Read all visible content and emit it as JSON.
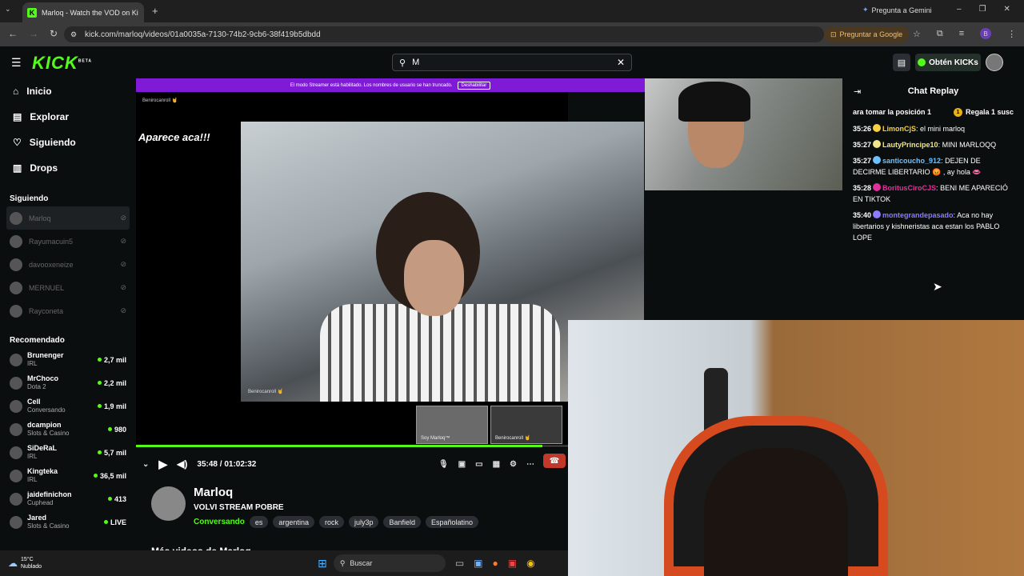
{
  "browser": {
    "tab_title": "Marloq - Watch the VOD on Ki",
    "new_tab": "+",
    "gemini_label": "Pregunta a Gemini",
    "url": "kick.com/marloq/videos/01a0035a-7130-74b2-9cb6-38f419b5dbdd",
    "ask_google": "Preguntar a Google",
    "profile_initial": "B"
  },
  "header": {
    "logo": "KICK",
    "logo_badge": "BETA",
    "search_value": "M",
    "get_kicks": "Obtén KICKs"
  },
  "nav": [
    {
      "label": "Inicio",
      "icon": "home-icon"
    },
    {
      "label": "Explorar",
      "icon": "compass-icon"
    },
    {
      "label": "Siguiendo",
      "icon": "heart-icon"
    },
    {
      "label": "Drops",
      "icon": "drops-icon"
    }
  ],
  "following": {
    "title": "Siguiendo",
    "items": [
      "Marloq",
      "Rayumacuin5",
      "davooxeneize",
      "MERNUEL",
      "Rayconeta"
    ]
  },
  "recommended": {
    "title": "Recomendado",
    "items": [
      {
        "name": "Brunenger",
        "cat": "IRL",
        "viewers": "2,7 mil"
      },
      {
        "name": "MrChoco",
        "cat": "Dota 2",
        "viewers": "2,2 mil"
      },
      {
        "name": "Cell",
        "cat": "Conversando",
        "viewers": "1,9 mil"
      },
      {
        "name": "dcampion",
        "cat": "Slots & Casino",
        "viewers": "980"
      },
      {
        "name": "SiDeRaL",
        "cat": "IRL",
        "viewers": "5,7 mil"
      },
      {
        "name": "Kingteka",
        "cat": "IRL",
        "viewers": "36,5 mil"
      },
      {
        "name": "jaidefinichon",
        "cat": "Cuphead",
        "viewers": "413"
      },
      {
        "name": "Jared",
        "cat": "Slots & Casino",
        "viewers": "LIVE"
      }
    ]
  },
  "player": {
    "banner": "El modo Streamer está habilitado. Los nombres de usuario se han truncado.",
    "banner_button": "Deshabilitar",
    "overlay_user": "Benirocanroll 🤘",
    "overlay_text": "Aparece aca!!!",
    "cam_label": "Benirocanroll 🤘",
    "mini1": "Soy Marloq™",
    "mini2": "Benirocanroll 🤘",
    "current_time": "35:48",
    "separator": "/",
    "duration": "01:02:32",
    "progress": 0.94
  },
  "stream": {
    "channel": "Marloq",
    "title": "VOLVI STREAM POBRE",
    "category": "Conversando",
    "tags": [
      "es",
      "argentina",
      "rock",
      "july3p",
      "Banfield",
      "Españolatino"
    ],
    "more_videos": "Más videos de Marloq"
  },
  "chat": {
    "title": "Chat Replay",
    "pinned_left": "ara tomar la posición 1",
    "pinned_right": "Regala 1 susc",
    "messages": [
      {
        "time": "35:26",
        "user": "LimonCjS",
        "color": "#f5d142",
        "text": "el mini marloq"
      },
      {
        "time": "35:27",
        "user": "LautyPrincipe10",
        "color": "#f0e68c",
        "text": "MINI MARLOQQ"
      },
      {
        "time": "35:27",
        "user": "santicoucho_912",
        "color": "#6ec1ff",
        "text": "DEJEN DE DECIRME LIBERTARIO 😡 , ay hola 👄"
      },
      {
        "time": "35:28",
        "user": "BoritusCiroCJS",
        "color": "#e0309b",
        "text": "BENI ME APARECIÓ EN TIKTOK"
      },
      {
        "time": "35:40",
        "user": "montegrandepasado",
        "color": "#8c7bff",
        "text": "Aca no hay libertarios y kishneristas aca estan los PABLO LOPE"
      }
    ]
  },
  "taskbar": {
    "temp": "15°C",
    "weather": "Nublado",
    "search": "Buscar"
  },
  "colors": {
    "accent": "#53fc18",
    "banner": "#7f1bd6"
  }
}
